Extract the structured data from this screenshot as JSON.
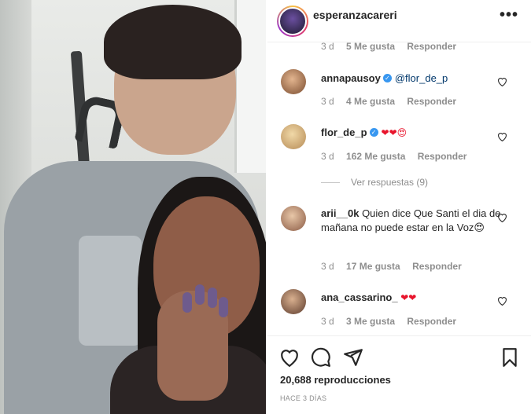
{
  "header": {
    "username": "esperanzacareri",
    "more_label": "•••"
  },
  "comments": [
    {
      "username": "",
      "text": "",
      "time": "3 d",
      "likes": "5 Me gusta",
      "reply_label": "Responder"
    },
    {
      "username": "annapausoy",
      "verified": true,
      "text": "@flor_de_p",
      "time": "3 d",
      "likes": "4 Me gusta",
      "reply_label": "Responder"
    },
    {
      "username": "flor_de_p",
      "verified": true,
      "text": "❤❤😍",
      "time": "3 d",
      "likes": "162 Me gusta",
      "reply_label": "Responder",
      "view_replies": "Ver respuestas (9)"
    },
    {
      "username": "arii__0k",
      "text": "Quien dice Que Santi el dia de mañana no puede estar en la Voz😍",
      "time": "3 d",
      "likes": "17 Me gusta",
      "reply_label": "Responder"
    },
    {
      "username": "ana_cassarino_",
      "text": "❤❤",
      "time": "3 d",
      "likes": "3 Me gusta",
      "reply_label": "Responder"
    }
  ],
  "actions": {
    "like_icon": "heart-icon",
    "comment_icon": "comment-icon",
    "share_icon": "send-icon",
    "save_icon": "bookmark-icon"
  },
  "stats": {
    "views": "20,688 reproducciones",
    "posted": "HACE 3 DÍAS"
  },
  "colors": {
    "heart_red": "#e8142c",
    "verified_blue": "#3897f0",
    "mention_blue": "#00376b",
    "meta_gray": "#8e8e8e"
  }
}
